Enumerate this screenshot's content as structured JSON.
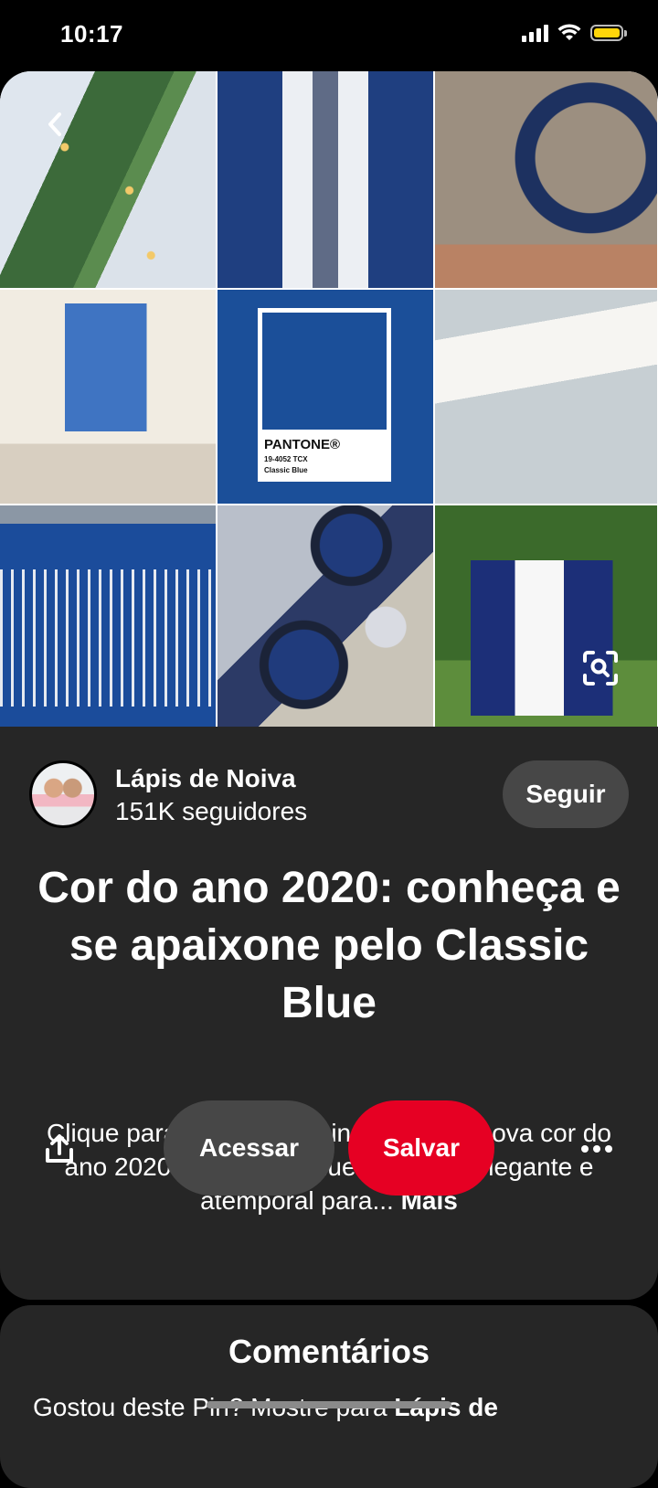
{
  "status_bar": {
    "time": "10:17",
    "icons": [
      "cellular-signal-icon",
      "wifi-icon",
      "battery-icon"
    ],
    "battery_color": "#ffd60a"
  },
  "pin": {
    "collage_images": [
      "table-setting-image",
      "groom-suit-image",
      "moon-backdrop-image",
      "blue-cake-image",
      "pantone-classic-blue-image",
      "wedding-invitations-image",
      "escort-card-wall-image",
      "constellation-plates-image",
      "bridesmaids-image"
    ],
    "pantone_chip": {
      "brand": "PANTONE®",
      "code": "19-4052 TCX",
      "name": "Classic Blue",
      "color": "#1b4f99"
    },
    "creator": {
      "name": "Lápis de Noiva",
      "followers": "151K seguidores"
    },
    "follow_label": "Seguir",
    "title": "Cor do ano 2020: conheça e se apaixone pelo Classic Blue",
    "description": "Clique para conhecer se inspirar pelo nova cor do ano 2020 - o Classic Blue. Uma cor elegante e atemporal para...",
    "more_label": "Mais",
    "visit_label": "Acessar",
    "save_label": "Salvar",
    "save_color": "#e60023"
  },
  "comments": {
    "title": "Comentários",
    "prompt": "Gostou deste Pin? Mostre para",
    "prompt_bold": "Lápis de"
  }
}
